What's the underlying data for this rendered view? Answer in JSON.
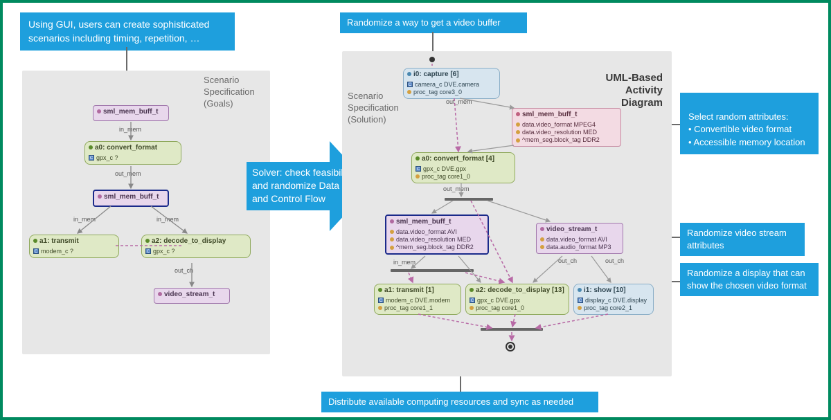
{
  "callouts": {
    "gui": "Using GUI, users can create sophisticated scenarios including timing, repetition, …",
    "top": "Randomize a way to get a video buffer",
    "attrs": "Select random attributes:\n• Convertible video format\n• Accessible memory location",
    "stream": "Randomize video stream attributes",
    "disp": "Randomize a display that can show the chosen video format",
    "bottom": "Distribute available computing resources and sync as needed"
  },
  "arrow_text": "Solver: check feasibility and randomize Data and Control Flow",
  "labels": {
    "goals": "Scenario Specification (Goals)",
    "solution": "Scenario Specification (Solution)",
    "uml": "UML-Based Activity Diagram"
  },
  "left": {
    "n0": "sml_mem_buff_t",
    "n1": {
      "t": "a0: convert_format",
      "r": "gpx_c    ?"
    },
    "n2": "sml_mem_buff_t",
    "n3": {
      "t": "a1: transmit",
      "r": "modem_c  ?"
    },
    "n4": {
      "t": "a2: decode_to_display",
      "r": "gpx_c    ?"
    },
    "n5": "video_stream_t",
    "e": {
      "in": "in_mem",
      "out": "out_mem",
      "in2a": "in_mem",
      "in2b": "in_mem",
      "outc": "out_ch"
    }
  },
  "right": {
    "cap": {
      "t": "i0: capture [6]",
      "r1": "camera_c  DVE.camera",
      "r2": "proc_tag  core3_0"
    },
    "buf1": {
      "t": "sml_mem_buff_t",
      "r1": "data.video_format    MPEG4",
      "r2": "data.video_resolution  MED",
      "r3": "^mem_seg.block_tag  DDR2"
    },
    "conv": {
      "t": "a0: convert_format [4]",
      "r1": "gpx_c     DVE.gpx",
      "r2": "proc_tag  core1_0"
    },
    "buf2": {
      "t": "sml_mem_buff_t",
      "r1": "data.video_format    AVI",
      "r2": "data.video_resolution  MED",
      "r3": "^mem_seg.block_tag  DDR2"
    },
    "vstr": {
      "t": "video_stream_t",
      "r1": "data.video_format  AVI",
      "r2": "data.audio_format  MP3"
    },
    "tx": {
      "t": "a1: transmit [1]",
      "r1": "modem_c  DVE.modem",
      "r2": "proc_tag  core1_1"
    },
    "dec": {
      "t": "a2: decode_to_display [13]",
      "r1": "gpx_c     DVE.gpx",
      "r2": "proc_tag  core1_0"
    },
    "show": {
      "t": "i1: show [10]",
      "r1": "display_c  DVE.display",
      "r2": "proc_tag  core2_1"
    },
    "e": {
      "out": "out_mem",
      "out2": "out_mem",
      "in": "in_mem",
      "outc1": "out_ch",
      "outc2": "out_ch"
    }
  }
}
